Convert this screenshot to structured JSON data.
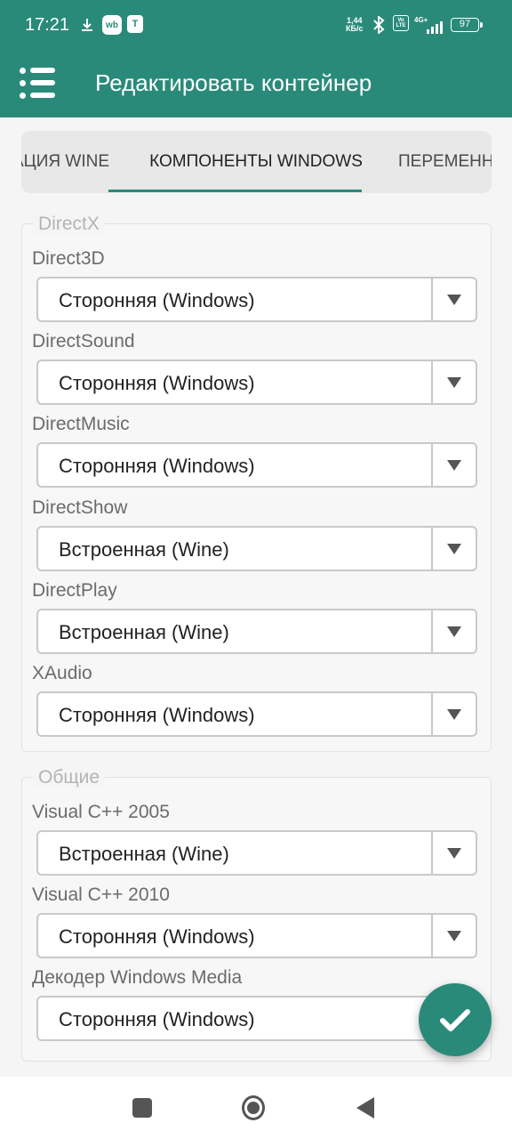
{
  "status_bar": {
    "time": "17:21",
    "speed_value": "1,44",
    "speed_unit": "КБ/с",
    "network": "4G+",
    "battery": "97",
    "icons": [
      "download-icon",
      "wb-app-icon",
      "t-app-icon",
      "bluetooth-icon",
      "volte-icon",
      "signal-icon",
      "battery-icon"
    ]
  },
  "app_bar": {
    "title": "Редактировать контейнер"
  },
  "tabs": [
    {
      "label": "АЦИЯ WINE",
      "active": false
    },
    {
      "label": "КОМПОНЕНТЫ WINDOWS",
      "active": true
    },
    {
      "label": "ПЕРЕМЕНН",
      "active": false
    }
  ],
  "sections": {
    "directx": {
      "title": "DirectX",
      "fields": [
        {
          "label": "Direct3D",
          "value": "Сторонняя (Windows)"
        },
        {
          "label": "DirectSound",
          "value": "Сторонняя (Windows)"
        },
        {
          "label": "DirectMusic",
          "value": "Сторонняя (Windows)"
        },
        {
          "label": "DirectShow",
          "value": "Встроенная (Wine)"
        },
        {
          "label": "DirectPlay",
          "value": "Встроенная (Wine)"
        },
        {
          "label": "XAudio",
          "value": "Сторонняя (Windows)"
        }
      ]
    },
    "general": {
      "title": "Общие",
      "fields": [
        {
          "label": "Visual C++ 2005",
          "value": "Встроенная (Wine)"
        },
        {
          "label": "Visual C++ 2010",
          "value": "Сторонняя (Windows)"
        },
        {
          "label": "Декодер Windows Media",
          "value": "Сторонняя (Windows)"
        }
      ]
    }
  },
  "colors": {
    "primary": "#2a8a7a",
    "background": "#f5f5f5"
  }
}
